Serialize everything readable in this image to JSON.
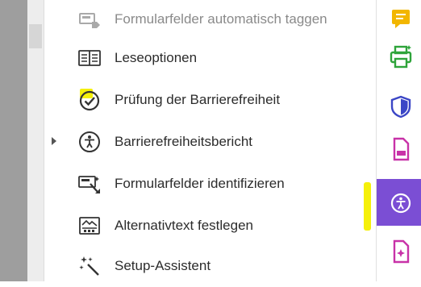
{
  "tools": [
    {
      "label": "Formularfelder automatisch taggen",
      "icon": "auto-tag-form-icon",
      "state": "dimmed"
    },
    {
      "label": "Leseoptionen",
      "icon": "reading-options-icon"
    },
    {
      "label": "Prüfung der Barrierefreiheit",
      "icon": "accessibility-check-icon",
      "highlighted": true
    },
    {
      "label": "Barrierefreiheitsbericht",
      "icon": "accessibility-report-icon"
    },
    {
      "label": "Formularfelder identifizieren",
      "icon": "identify-form-fields-icon"
    },
    {
      "label": "Alternativtext festlegen",
      "icon": "alt-text-icon"
    },
    {
      "label": "Setup-Assistent",
      "icon": "setup-wizard-icon"
    }
  ],
  "right_toolbar": [
    {
      "icon": "comment-icon",
      "color": "#f2b600"
    },
    {
      "icon": "print-production-icon",
      "color": "#2ea43a"
    },
    {
      "icon": "protect-shield-icon",
      "color": "#3b46c6"
    },
    {
      "icon": "pdf-export-icon",
      "color": "#c832a8"
    },
    {
      "icon": "accessibility-icon",
      "color": "#ffffff",
      "active": true
    },
    {
      "icon": "rich-media-icon",
      "color": "#c832a8"
    }
  ],
  "colors": {
    "active_tool_bg": "#7b4ed4",
    "highlight": "#f5f00a"
  }
}
